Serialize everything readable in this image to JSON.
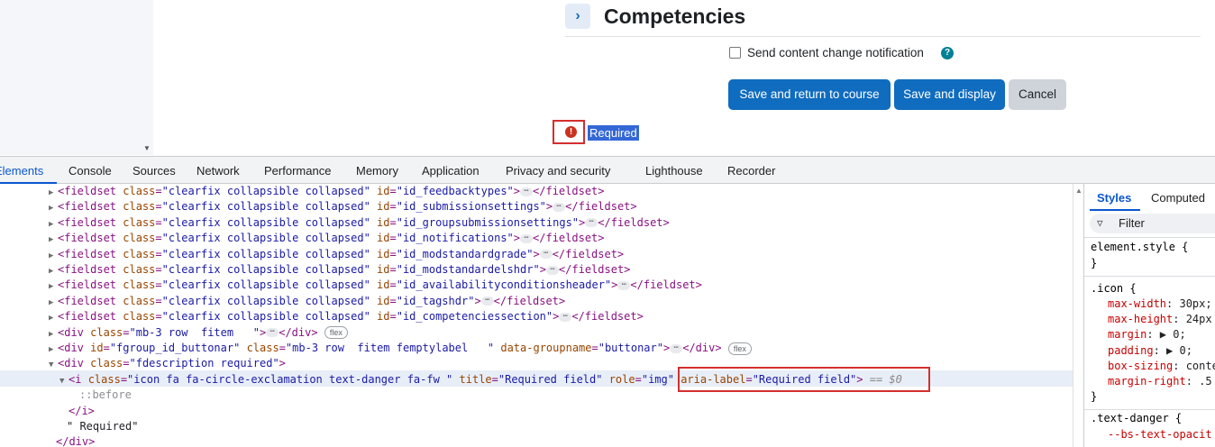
{
  "page": {
    "section_title": "Competencies",
    "notify_label": "Send content change notification",
    "help_icon": "?",
    "buttons": {
      "save_return": "Save and return to course",
      "save_display": "Save and display",
      "cancel": "Cancel"
    },
    "required_icon": "!",
    "required_text": "Required"
  },
  "devtools": {
    "tabs": [
      "Elements",
      "Console",
      "Sources",
      "Network",
      "Performance",
      "Memory",
      "Application",
      "Privacy and security",
      "Lighthouse",
      "Recorder"
    ],
    "fieldsets": [
      "id_feedbacktypes",
      "id_submissionsettings",
      "id_groupsubmissionsettings",
      "id_notifications",
      "id_modstandardgrade",
      "id_modstandardelshdr",
      "id_availabilityconditionsheader",
      "id_tagshdr",
      "id_competenciessection"
    ],
    "fieldset_class": "clearfix collapsible collapsed",
    "div1_class": "mb-3 row  fitem   ",
    "div2_id": "fgroup_id_buttonar",
    "div2_class": "mb-3 row  fitem femptylabel   ",
    "div2_groupname": "buttonar",
    "flex_badge": "flex",
    "div3_class": "fdescription required",
    "i_class": "icon fa fa-circle-exclamation text-danger fa-fw ",
    "i_title": "Required field",
    "i_role": "img",
    "i_aria_label": "Required field",
    "i_suffix": "== $0",
    "before": "::before",
    "text_node": "\" Required\"",
    "styles": {
      "tabs": [
        "Styles",
        "Computed"
      ],
      "filter": "Filter",
      "element_style": "element.style {",
      "icon_selector": ".icon {",
      "icon_props": [
        {
          "name": "max-width",
          "value": "30px;"
        },
        {
          "name": "max-height",
          "value": "24px"
        },
        {
          "name": "margin",
          "value": "▶ 0;"
        },
        {
          "name": "padding",
          "value": "▶ 0;"
        },
        {
          "name": "box-sizing",
          "value": "conte"
        },
        {
          "name": "margin-right",
          "value": ".5"
        }
      ],
      "text_danger_selector": ".text-danger {",
      "text_danger_prop": "--bs-text-opacit"
    }
  }
}
